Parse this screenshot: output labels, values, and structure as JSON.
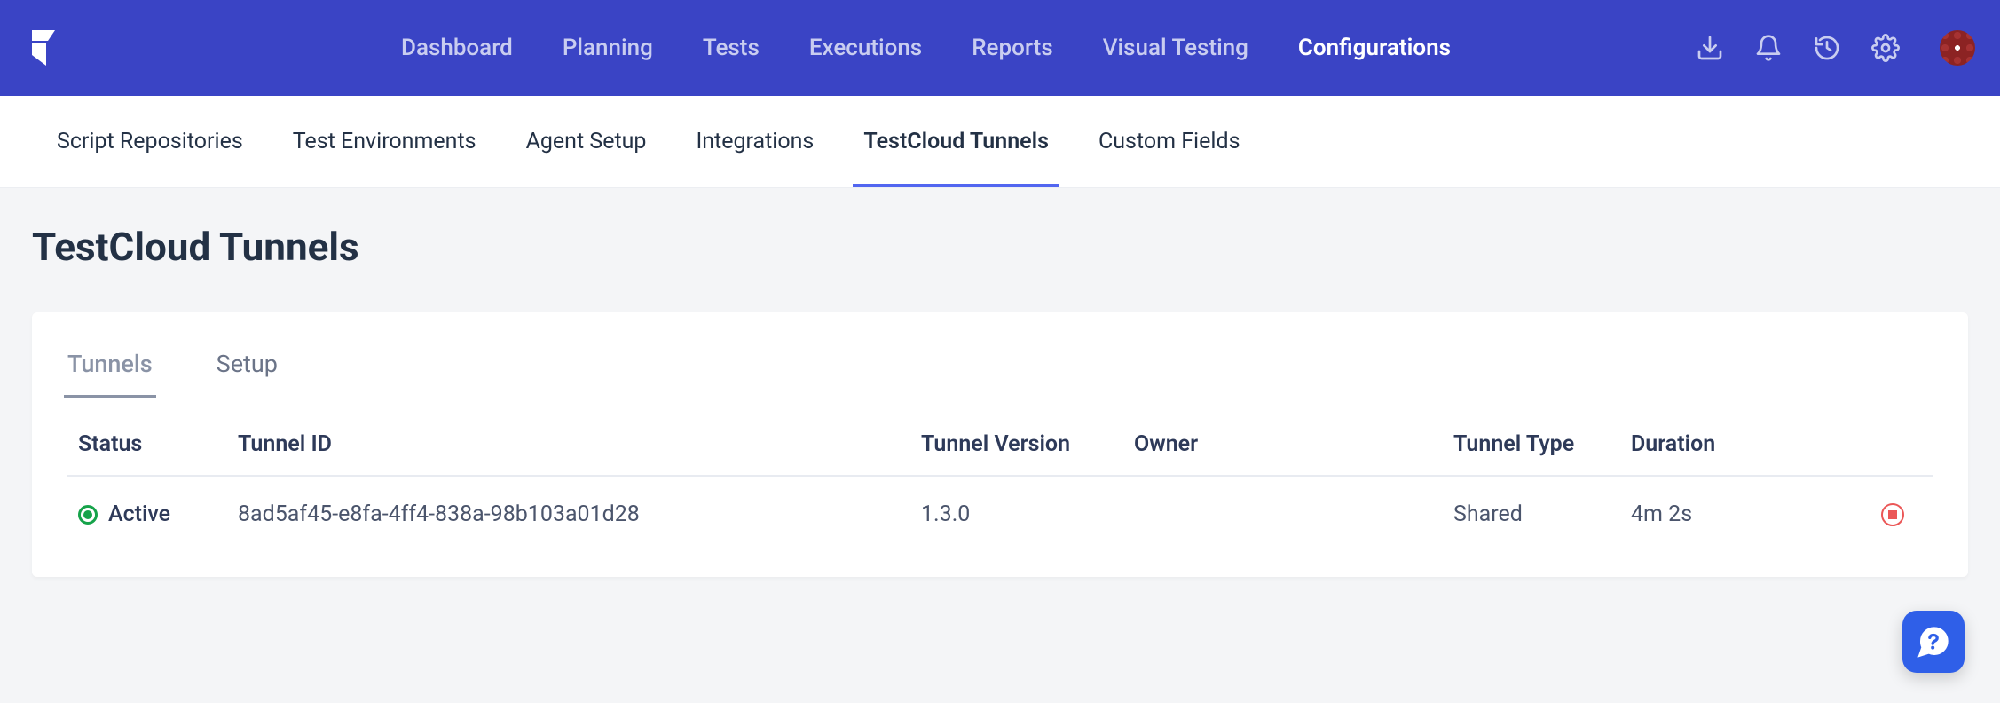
{
  "topnav": {
    "items": [
      {
        "label": "Dashboard"
      },
      {
        "label": "Planning"
      },
      {
        "label": "Tests"
      },
      {
        "label": "Executions"
      },
      {
        "label": "Reports"
      },
      {
        "label": "Visual Testing"
      },
      {
        "label": "Configurations"
      }
    ],
    "active_index": 6
  },
  "subnav": {
    "items": [
      {
        "label": "Script Repositories"
      },
      {
        "label": "Test Environments"
      },
      {
        "label": "Agent Setup"
      },
      {
        "label": "Integrations"
      },
      {
        "label": "TestCloud Tunnels"
      },
      {
        "label": "Custom Fields"
      }
    ],
    "active_index": 4
  },
  "page": {
    "title": "TestCloud Tunnels"
  },
  "card": {
    "tabs": [
      {
        "label": "Tunnels"
      },
      {
        "label": "Setup"
      }
    ],
    "active_tab_index": 0,
    "table": {
      "headers": {
        "status": "Status",
        "id": "Tunnel ID",
        "version": "Tunnel Version",
        "owner": "Owner",
        "type": "Tunnel Type",
        "duration": "Duration"
      },
      "rows": [
        {
          "status": "Active",
          "id": "8ad5af45-e8fa-4ff4-838a-98b103a01d28",
          "version": "1.3.0",
          "owner": "",
          "type": "Shared",
          "duration": "4m 2s"
        }
      ]
    }
  }
}
